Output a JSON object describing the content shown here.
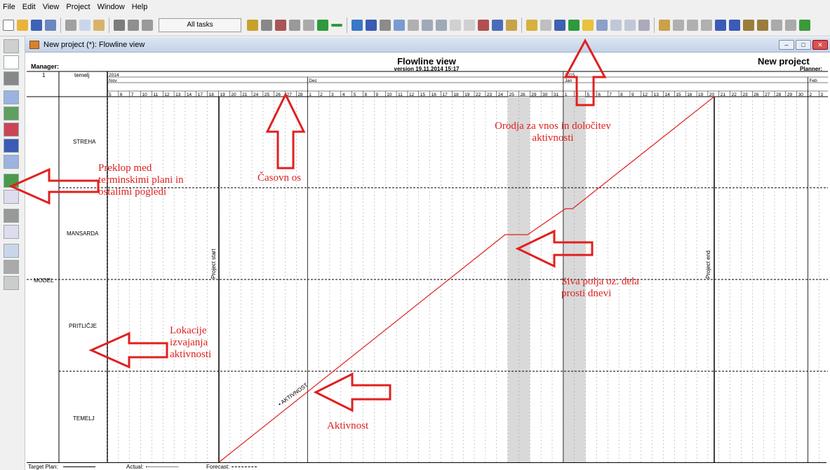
{
  "menu": [
    "File",
    "Edit",
    "View",
    "Project",
    "Window",
    "Help"
  ],
  "toolbar": {
    "all_tasks_label": "All tasks"
  },
  "window": {
    "title": "New project (*): Flowline view",
    "min": "–",
    "max": "□",
    "close": "✕"
  },
  "header": {
    "manager_label": "Manager:",
    "title": "Flowline view",
    "version": "version 19.11.2014 15:17",
    "project_name": "New project",
    "planner_label": "Planner:"
  },
  "columns": {
    "num": "1",
    "name": "temelj"
  },
  "timeline": {
    "years": [
      {
        "label": "2014"
      },
      {
        "label": "2015"
      }
    ],
    "months": [
      {
        "label": "Nov"
      },
      {
        "label": "Dec"
      },
      {
        "label": "Jan"
      },
      {
        "label": "Feb"
      }
    ],
    "days": [
      "5",
      "6",
      "7",
      "10",
      "11",
      "12",
      "13",
      "14",
      "17",
      "18",
      "19",
      "20",
      "21",
      "24",
      "25",
      "26",
      "27",
      "28",
      "1",
      "2",
      "3",
      "4",
      "5",
      "8",
      "9",
      "10",
      "11",
      "12",
      "15",
      "16",
      "17",
      "18",
      "19",
      "22",
      "23",
      "24",
      "25",
      "26",
      "29",
      "30",
      "31",
      "1",
      "2",
      "5",
      "6",
      "7",
      "8",
      "9",
      "12",
      "13",
      "14",
      "15",
      "16",
      "19",
      "20",
      "21",
      "22",
      "23",
      "26",
      "27",
      "28",
      "29",
      "30",
      "2",
      "3"
    ]
  },
  "locations": {
    "model": "MODEL",
    "rows": [
      "STREHA",
      "MANSARDA",
      "PRITLIČJE",
      "TEMELJ"
    ]
  },
  "markers": {
    "start": "Project start",
    "end": "Project end"
  },
  "activity": {
    "label": "• AKTIVNOST"
  },
  "legend": {
    "target": "Target Plan:",
    "actual": "Actual:",
    "forecast": "Forecast:"
  },
  "annotations": {
    "tools": "Orodja za vnos in določitev aktivnosti",
    "axis": "Časovn os",
    "switch": "Preklop med terminskimi plani in ostalimi pogledi",
    "grey": "Siva polja oz. dela prosti dnevi",
    "locations": "Lokacije izvajanja aktivnosti",
    "activity": "Aktivnost"
  },
  "colors": {
    "accent": "#e0201f",
    "weekend": "#d9d9d9",
    "activity_line": "#e0201f"
  }
}
